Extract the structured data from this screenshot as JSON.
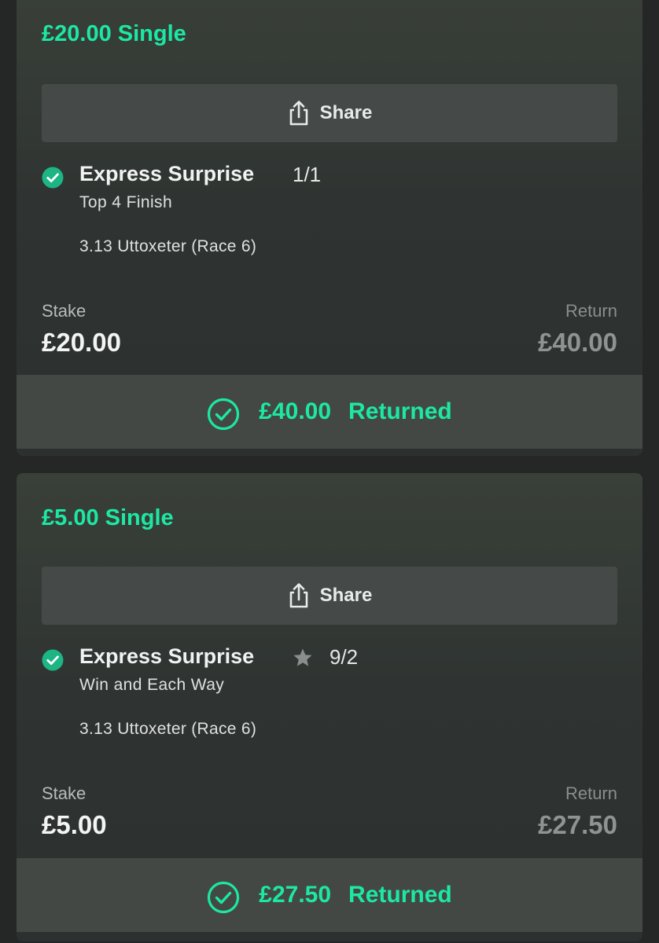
{
  "colors": {
    "accent": "#1ce8a4",
    "check_fill": "#1db584",
    "card_background": "#2f3432",
    "panel": "#434845",
    "page_background": "#252626"
  },
  "bets": [
    {
      "title": "£20.00 Single",
      "share": {
        "label": "Share",
        "icon": "share-icon"
      },
      "selection": {
        "status_icon": "check-circle-icon",
        "runner": "Express Surprise",
        "odds": "1/1",
        "market": "Top 4 Finish",
        "event": "3.13 Uttoxeter (Race 6)"
      },
      "stake_label": "Stake",
      "stake": "£20.00",
      "return_label": "Return",
      "return": "£40.00",
      "result": {
        "icon": "check-circle-outline-icon",
        "amount": "£40.00",
        "label": "Returned"
      }
    },
    {
      "title": "£5.00 Single",
      "share": {
        "label": "Share",
        "icon": "share-icon"
      },
      "selection": {
        "status_icon": "check-circle-icon",
        "runner": "Express Surprise",
        "badge_icon": "star-icon",
        "odds": "9/2",
        "market": "Win and Each Way",
        "event": "3.13 Uttoxeter (Race 6)"
      },
      "stake_label": "Stake",
      "stake": "£5.00",
      "return_label": "Return",
      "return": "£27.50",
      "result": {
        "icon": "check-circle-outline-icon",
        "amount": "£27.50",
        "label": "Returned"
      }
    }
  ]
}
